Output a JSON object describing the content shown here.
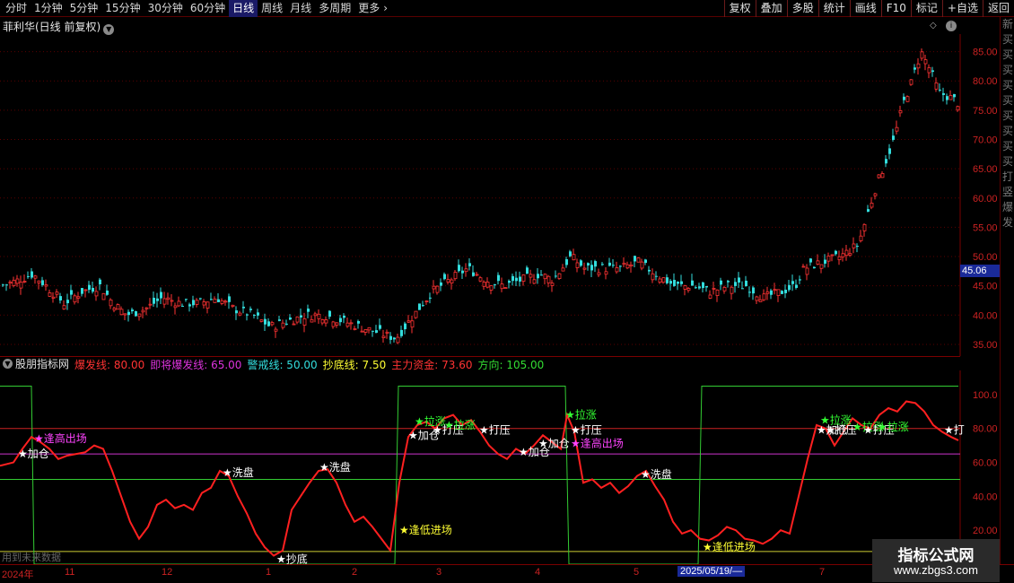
{
  "toolbar": {
    "periods": [
      "分时",
      "1分钟",
      "5分钟",
      "15分钟",
      "30分钟",
      "60分钟",
      "日线",
      "周线",
      "月线",
      "多周期",
      "更多"
    ],
    "active_period": "日线",
    "more_icon": "chevron-right-icon",
    "tools": [
      "复权",
      "叠加",
      "多股",
      "统计",
      "画线",
      "F10",
      "标记",
      "+自选",
      "返回"
    ]
  },
  "main_chart": {
    "title": "菲利华(日线 前复权)",
    "current_price_tag": "45.06",
    "y_ticks": [
      "85.00",
      "80.00",
      "75.00",
      "70.00",
      "65.00",
      "60.00",
      "55.00",
      "50.00",
      "45.00",
      "40.00",
      "35.00"
    ],
    "up_color": "#ff3333",
    "down_color": "#33dddd"
  },
  "indicator": {
    "name": "股朋指标网",
    "params": [
      {
        "text": "爆发线: 80.00",
        "color": "#ff3333"
      },
      {
        "text": "即将爆发线: 65.00",
        "color": "#dd33dd"
      },
      {
        "text": "警戒线: 50.00",
        "color": "#33dddd"
      },
      {
        "text": "抄底线: 7.50",
        "color": "#ffff33"
      },
      {
        "text": "主力资金: 73.60",
        "color": "#ff3333"
      },
      {
        "text": "方向: 105.00",
        "color": "#33dd33"
      }
    ],
    "y_ticks": [
      "100.0",
      "80.00",
      "60.00",
      "40.00",
      "20.00"
    ],
    "footnote": "用到未来数据",
    "signals": [
      {
        "text": "加仓",
        "color": "#ffffff"
      },
      {
        "text": "逢高出场",
        "color": "#ff44ff"
      },
      {
        "text": "洗盘",
        "color": "#ffffff"
      },
      {
        "text": "洗盘",
        "color": "#ffffff"
      },
      {
        "text": "抄底",
        "color": "#ffffff"
      },
      {
        "text": "逢低进场",
        "color": "#ffff33"
      },
      {
        "text": "加仓",
        "color": "#ffffff"
      },
      {
        "text": "拉涨",
        "color": "#33ff33"
      },
      {
        "text": "打压",
        "color": "#ffffff"
      },
      {
        "text": "拉涨",
        "color": "#33ff33"
      },
      {
        "text": "打压",
        "color": "#ffffff"
      },
      {
        "text": "加仓",
        "color": "#ffffff"
      },
      {
        "text": "加仓",
        "color": "#ffffff"
      },
      {
        "text": "拉涨",
        "color": "#33ff33"
      },
      {
        "text": "打压",
        "color": "#ffffff"
      },
      {
        "text": "逢高出场",
        "color": "#ff44ff"
      },
      {
        "text": "洗盘",
        "color": "#ffffff"
      },
      {
        "text": "逢低进场",
        "color": "#ffff33"
      },
      {
        "text": "拉涨",
        "color": "#33ff33"
      },
      {
        "text": "加仓",
        "color": "#ffffff"
      },
      {
        "text": "打压",
        "color": "#ffffff"
      },
      {
        "text": "拉涨",
        "color": "#33ff33"
      },
      {
        "text": "打压",
        "color": "#ffffff"
      },
      {
        "text": "拉涨",
        "color": "#33ff33"
      },
      {
        "text": "打",
        "color": "#ffffff"
      }
    ]
  },
  "date_axis": {
    "labels": [
      "2024年",
      "11",
      "12",
      "1",
      "2",
      "3",
      "4",
      "5",
      "2025/05/19/—",
      "7"
    ],
    "cursor_label": "2025/05/19/—"
  },
  "side_panel_chars": "新买买买买买买买买买打竖爆发",
  "watermark": {
    "title": "指标公式网",
    "url": "www.zbgs3.com"
  },
  "chart_data": [
    {
      "type": "candlestick",
      "title": "菲利华(日线 前复权)",
      "ylim": [
        33,
        88
      ],
      "y_ticks": [
        85,
        80,
        75,
        70,
        65,
        60,
        55,
        50,
        45,
        40,
        35
      ],
      "close_path": [
        [
          0,
          45
        ],
        [
          20,
          46
        ],
        [
          35,
          47
        ],
        [
          50,
          45
        ],
        [
          70,
          42
        ],
        [
          90,
          44
        ],
        [
          110,
          45
        ],
        [
          125,
          42
        ],
        [
          140,
          40
        ],
        [
          160,
          41
        ],
        [
          180,
          43
        ],
        [
          200,
          42
        ],
        [
          220,
          42
        ],
        [
          240,
          43
        ],
        [
          260,
          41
        ],
        [
          280,
          40
        ],
        [
          300,
          38
        ],
        [
          320,
          39
        ],
        [
          340,
          40
        ],
        [
          360,
          40
        ],
        [
          380,
          39
        ],
        [
          400,
          38
        ],
        [
          420,
          37
        ],
        [
          440,
          36
        ],
        [
          460,
          40
        ],
        [
          480,
          44
        ],
        [
          500,
          46
        ],
        [
          520,
          48
        ],
        [
          540,
          46
        ],
        [
          560,
          45
        ],
        [
          580,
          46
        ],
        [
          600,
          47
        ],
        [
          615,
          46
        ],
        [
          625,
          48
        ],
        [
          635,
          50
        ],
        [
          650,
          48
        ],
        [
          670,
          48
        ],
        [
          690,
          48
        ],
        [
          710,
          49
        ],
        [
          730,
          47
        ],
        [
          750,
          45
        ],
        [
          770,
          45
        ],
        [
          790,
          44
        ],
        [
          810,
          45
        ],
        [
          830,
          45
        ],
        [
          850,
          43
        ],
        [
          870,
          44
        ],
        [
          885,
          45
        ],
        [
          895,
          48
        ],
        [
          915,
          49
        ],
        [
          935,
          50
        ],
        [
          955,
          52
        ],
        [
          965,
          57
        ],
        [
          975,
          62
        ],
        [
          985,
          66
        ],
        [
          995,
          70
        ],
        [
          1005,
          76
        ],
        [
          1015,
          80
        ],
        [
          1025,
          85
        ],
        [
          1035,
          82
        ],
        [
          1045,
          78
        ],
        [
          1060,
          77
        ],
        [
          1068,
          76
        ]
      ]
    },
    {
      "type": "line",
      "name": "股朋指标网",
      "ylim": [
        0,
        110
      ],
      "reference_lines": [
        {
          "name": "爆发线",
          "value": 80.0
        },
        {
          "name": "即将爆发线",
          "value": 65.0
        },
        {
          "name": "警戒线",
          "value": 50.0
        },
        {
          "name": "抄底线",
          "value": 7.5
        }
      ],
      "series": [
        {
          "name": "主力资金",
          "points": [
            [
              0,
              58
            ],
            [
              15,
              60
            ],
            [
              25,
              68
            ],
            [
              35,
              75
            ],
            [
              45,
              72
            ],
            [
              55,
              68
            ],
            [
              65,
              62
            ],
            [
              75,
              64
            ],
            [
              85,
              65
            ],
            [
              95,
              66
            ],
            [
              105,
              70
            ],
            [
              115,
              68
            ],
            [
              125,
              55
            ],
            [
              135,
              40
            ],
            [
              145,
              25
            ],
            [
              155,
              15
            ],
            [
              165,
              22
            ],
            [
              175,
              35
            ],
            [
              185,
              38
            ],
            [
              195,
              33
            ],
            [
              205,
              35
            ],
            [
              215,
              32
            ],
            [
              225,
              42
            ],
            [
              235,
              45
            ],
            [
              245,
              55
            ],
            [
              255,
              52
            ],
            [
              265,
              40
            ],
            [
              275,
              30
            ],
            [
              285,
              18
            ],
            [
              295,
              10
            ],
            [
              305,
              5
            ],
            [
              315,
              8
            ],
            [
              325,
              32
            ],
            [
              335,
              40
            ],
            [
              345,
              48
            ],
            [
              355,
              55
            ],
            [
              365,
              56
            ],
            [
              375,
              48
            ],
            [
              385,
              35
            ],
            [
              395,
              25
            ],
            [
              405,
              28
            ],
            [
              415,
              22
            ],
            [
              425,
              15
            ],
            [
              435,
              8
            ],
            [
              445,
              48
            ],
            [
              455,
              75
            ],
            [
              465,
              82
            ],
            [
              475,
              84
            ],
            [
              485,
              80
            ],
            [
              495,
              86
            ],
            [
              505,
              88
            ],
            [
              515,
              82
            ],
            [
              525,
              85
            ],
            [
              535,
              78
            ],
            [
              545,
              70
            ],
            [
              555,
              65
            ],
            [
              565,
              62
            ],
            [
              575,
              68
            ],
            [
              585,
              65
            ],
            [
              595,
              70
            ],
            [
              605,
              76
            ],
            [
              615,
              72
            ],
            [
              625,
              68
            ],
            [
              632,
              88
            ],
            [
              640,
              78
            ],
            [
              650,
              48
            ],
            [
              660,
              50
            ],
            [
              670,
              45
            ],
            [
              680,
              48
            ],
            [
              690,
              42
            ],
            [
              700,
              46
            ],
            [
              710,
              52
            ],
            [
              720,
              55
            ],
            [
              730,
              46
            ],
            [
              740,
              38
            ],
            [
              750,
              25
            ],
            [
              760,
              18
            ],
            [
              770,
              20
            ],
            [
              780,
              15
            ],
            [
              790,
              14
            ],
            [
              800,
              17
            ],
            [
              810,
              22
            ],
            [
              820,
              20
            ],
            [
              830,
              15
            ],
            [
              840,
              14
            ],
            [
              850,
              12
            ],
            [
              860,
              15
            ],
            [
              870,
              20
            ],
            [
              880,
              18
            ],
            [
              890,
              40
            ],
            [
              900,
              62
            ],
            [
              910,
              82
            ],
            [
              920,
              80
            ],
            [
              930,
              70
            ],
            [
              940,
              78
            ],
            [
              950,
              86
            ],
            [
              960,
              82
            ],
            [
              970,
              80
            ],
            [
              980,
              88
            ],
            [
              990,
              92
            ],
            [
              1000,
              90
            ],
            [
              1010,
              96
            ],
            [
              1020,
              95
            ],
            [
              1030,
              90
            ],
            [
              1040,
              82
            ],
            [
              1050,
              78
            ],
            [
              1060,
              75
            ],
            [
              1068,
              73
            ]
          ]
        },
        {
          "name": "方向",
          "points": [
            [
              0,
              105
            ],
            [
              35,
              105
            ],
            [
              38,
              0
            ],
            [
              440,
              0
            ],
            [
              444,
              105
            ],
            [
              630,
              105
            ],
            [
              634,
              0
            ],
            [
              778,
              0
            ],
            [
              782,
              105
            ],
            [
              1068,
              105
            ]
          ]
        }
      ]
    }
  ]
}
